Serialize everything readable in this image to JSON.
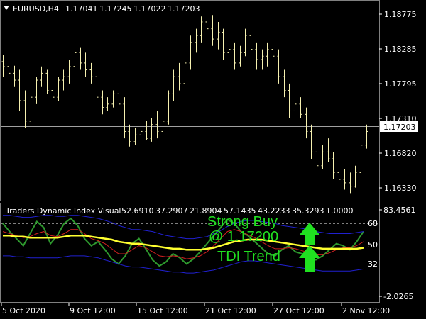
{
  "header": {
    "symbol": "EURUSD,H4",
    "ohlc": [
      "1.17041",
      "1.17245",
      "1.17022",
      "1.17203"
    ]
  },
  "price_axis": {
    "ticks": [
      "1.18775",
      "1.18285",
      "1.17795",
      "1.17310",
      "1.16820",
      "1.16330"
    ],
    "current_price": "1.17203"
  },
  "indicator": {
    "label": "Traders Dynamic Index Visual",
    "values": [
      "52.6910",
      "37.2907",
      "21.8904",
      "57.1435",
      "43.2233",
      "35.3293",
      "1.0000"
    ],
    "axis_ticks": [
      "83.4561",
      "68",
      "50",
      "32",
      "-2.0265"
    ],
    "levels": [
      68,
      50,
      32
    ]
  },
  "signal": {
    "line1": "Strong Buy",
    "line2": "@ 1.17200",
    "line3": "TDI Trend"
  },
  "time_axis": {
    "labels": [
      "5 Oct 2020",
      "9 Oct 12:00",
      "15 Oct 12:00",
      "21 Oct 12:00",
      "27 Oct 12:00",
      "2 Nov 12:00"
    ]
  },
  "colors": {
    "background": "#000000",
    "bars": "#f5f0b0",
    "grid": "#808080",
    "green": "#2e9a2e",
    "red": "#d02020",
    "yellow": "#ffff30",
    "blue": "#2020d0",
    "signal": "#20e020",
    "arrow": "#20e020"
  },
  "chart_data": {
    "type": "bar",
    "price_ylim": [
      1.161,
      1.19
    ],
    "price_bars": [
      [
        1.1812,
        1.1822,
        1.179,
        1.1805
      ],
      [
        1.1805,
        1.1815,
        1.1785,
        1.1795
      ],
      [
        1.1795,
        1.1806,
        1.1775,
        1.1785
      ],
      [
        1.1785,
        1.18,
        1.174,
        1.1755
      ],
      [
        1.1755,
        1.177,
        1.1715,
        1.1725
      ],
      [
        1.1725,
        1.1765,
        1.172,
        1.176
      ],
      [
        1.176,
        1.179,
        1.175,
        1.1785
      ],
      [
        1.1785,
        1.1805,
        1.1775,
        1.1795
      ],
      [
        1.1795,
        1.18,
        1.1765,
        1.177
      ],
      [
        1.177,
        1.178,
        1.1755,
        1.176
      ],
      [
        1.176,
        1.179,
        1.1755,
        1.1785
      ],
      [
        1.1785,
        1.18,
        1.177,
        1.179
      ],
      [
        1.179,
        1.1815,
        1.178,
        1.1805
      ],
      [
        1.1805,
        1.183,
        1.1795,
        1.1825
      ],
      [
        1.1825,
        1.1832,
        1.18,
        1.181
      ],
      [
        1.181,
        1.1825,
        1.179,
        1.18
      ],
      [
        1.18,
        1.181,
        1.178,
        1.179
      ],
      [
        1.179,
        1.1795,
        1.175,
        1.176
      ],
      [
        1.176,
        1.177,
        1.1735,
        1.1745
      ],
      [
        1.1745,
        1.176,
        1.174,
        1.175
      ],
      [
        1.175,
        1.177,
        1.1745,
        1.1765
      ],
      [
        1.1765,
        1.178,
        1.174,
        1.175
      ],
      [
        1.175,
        1.176,
        1.17,
        1.171
      ],
      [
        1.171,
        1.172,
        1.1688,
        1.1695
      ],
      [
        1.1695,
        1.1715,
        1.169,
        1.1705
      ],
      [
        1.1705,
        1.172,
        1.1695,
        1.171
      ],
      [
        1.171,
        1.1725,
        1.1698,
        1.17
      ],
      [
        1.17,
        1.173,
        1.1695,
        1.172
      ],
      [
        1.172,
        1.174,
        1.17,
        1.171
      ],
      [
        1.171,
        1.173,
        1.1705,
        1.1725
      ],
      [
        1.1725,
        1.177,
        1.172,
        1.1765
      ],
      [
        1.1765,
        1.18,
        1.1755,
        1.179
      ],
      [
        1.179,
        1.181,
        1.177,
        1.178
      ],
      [
        1.178,
        1.1815,
        1.1775,
        1.181
      ],
      [
        1.181,
        1.185,
        1.18,
        1.184
      ],
      [
        1.184,
        1.186,
        1.1825,
        1.185
      ],
      [
        1.185,
        1.1878,
        1.184,
        1.187
      ],
      [
        1.187,
        1.1885,
        1.1855,
        1.186
      ],
      [
        1.186,
        1.188,
        1.1835,
        1.1845
      ],
      [
        1.1845,
        1.187,
        1.183,
        1.1855
      ],
      [
        1.1855,
        1.186,
        1.1815,
        1.1825
      ],
      [
        1.1825,
        1.1845,
        1.1812,
        1.183
      ],
      [
        1.183,
        1.184,
        1.18,
        1.181
      ],
      [
        1.181,
        1.1835,
        1.1805,
        1.1825
      ],
      [
        1.1825,
        1.186,
        1.182,
        1.185
      ],
      [
        1.185,
        1.1865,
        1.182,
        1.183
      ],
      [
        1.183,
        1.184,
        1.18,
        1.1815
      ],
      [
        1.1815,
        1.183,
        1.18,
        1.182
      ],
      [
        1.182,
        1.184,
        1.1805,
        1.183
      ],
      [
        1.183,
        1.1845,
        1.181,
        1.182
      ],
      [
        1.182,
        1.183,
        1.178,
        1.179
      ],
      [
        1.179,
        1.18,
        1.176,
        1.177
      ],
      [
        1.177,
        1.178,
        1.173,
        1.174
      ],
      [
        1.174,
        1.176,
        1.172,
        1.175
      ],
      [
        1.175,
        1.176,
        1.173,
        1.1735
      ],
      [
        1.1735,
        1.1745,
        1.17,
        1.171
      ],
      [
        1.171,
        1.172,
        1.167,
        1.168
      ],
      [
        1.168,
        1.1695,
        1.165,
        1.166
      ],
      [
        1.166,
        1.169,
        1.1655,
        1.168
      ],
      [
        1.168,
        1.17,
        1.1665,
        1.167
      ],
      [
        1.167,
        1.168,
        1.164,
        1.165
      ],
      [
        1.165,
        1.1665,
        1.163,
        1.164
      ],
      [
        1.164,
        1.1655,
        1.1625,
        1.1635
      ],
      [
        1.1635,
        1.165,
        1.162,
        1.163
      ],
      [
        1.163,
        1.166,
        1.1628,
        1.165
      ],
      [
        1.165,
        1.17,
        1.1645,
        1.169
      ],
      [
        1.169,
        1.172,
        1.1685,
        1.171
      ]
    ],
    "tdi_ylim": [
      -2.0265,
      83.4561
    ],
    "tdi_series": [
      {
        "color_key": "green",
        "values": [
          70,
          62,
          55,
          48,
          60,
          72,
          66,
          50,
          58,
          70,
          75,
          68,
          55,
          48,
          52,
          44,
          35,
          30,
          38,
          50,
          55,
          45,
          34,
          28,
          32,
          40,
          36,
          30,
          35,
          42,
          50,
          58,
          66,
          74,
          70,
          62,
          58,
          52,
          46,
          40,
          38,
          44,
          48,
          42,
          40,
          36,
          34,
          38,
          44,
          50,
          48,
          44,
          52,
          62
        ]
      },
      {
        "color_key": "red",
        "values": [
          62,
          60,
          58,
          56,
          57,
          60,
          62,
          58,
          57,
          60,
          64,
          64,
          60,
          55,
          53,
          50,
          45,
          40,
          40,
          44,
          48,
          46,
          42,
          38,
          37,
          38,
          37,
          35,
          36,
          38,
          42,
          48,
          55,
          62,
          64,
          62,
          59,
          56,
          52,
          48,
          45,
          45,
          46,
          45,
          43,
          41,
          39,
          39,
          41,
          44,
          46,
          46,
          48,
          52
        ]
      },
      {
        "color_key": "yellow",
        "values": [
          58,
          58,
          57,
          57,
          56,
          56,
          56,
          56,
          56,
          57,
          58,
          58,
          58,
          57,
          56,
          55,
          54,
          52,
          51,
          50,
          50,
          49,
          48,
          47,
          46,
          45,
          45,
          44,
          44,
          44,
          45,
          46,
          48,
          50,
          52,
          53,
          54,
          54,
          54,
          53,
          52,
          51,
          50,
          49,
          48,
          47,
          46,
          45,
          45,
          45,
          45,
          45,
          45,
          46
        ]
      },
      {
        "color_key": "blue",
        "values": [
          78,
          78,
          77,
          76,
          76,
          77,
          78,
          78,
          77,
          77,
          78,
          78,
          77,
          76,
          75,
          73,
          71,
          68,
          66,
          64,
          64,
          63,
          62,
          60,
          58,
          57,
          56,
          55,
          55,
          56,
          57,
          60,
          63,
          67,
          70,
          72,
          73,
          73,
          72,
          71,
          70,
          68,
          67,
          66,
          65,
          64,
          62,
          61,
          60,
          60,
          60,
          60,
          61,
          62
        ]
      },
      {
        "color_key": "blue",
        "values": [
          38,
          38,
          37,
          37,
          36,
          36,
          36,
          36,
          36,
          37,
          38,
          38,
          38,
          37,
          36,
          34,
          32,
          30,
          28,
          27,
          27,
          26,
          25,
          24,
          23,
          22,
          22,
          21,
          21,
          22,
          23,
          24,
          26,
          28,
          30,
          32,
          33,
          33,
          32,
          31,
          30,
          29,
          28,
          27,
          26,
          25,
          24,
          23,
          23,
          23,
          23,
          23,
          24,
          25
        ]
      }
    ]
  }
}
